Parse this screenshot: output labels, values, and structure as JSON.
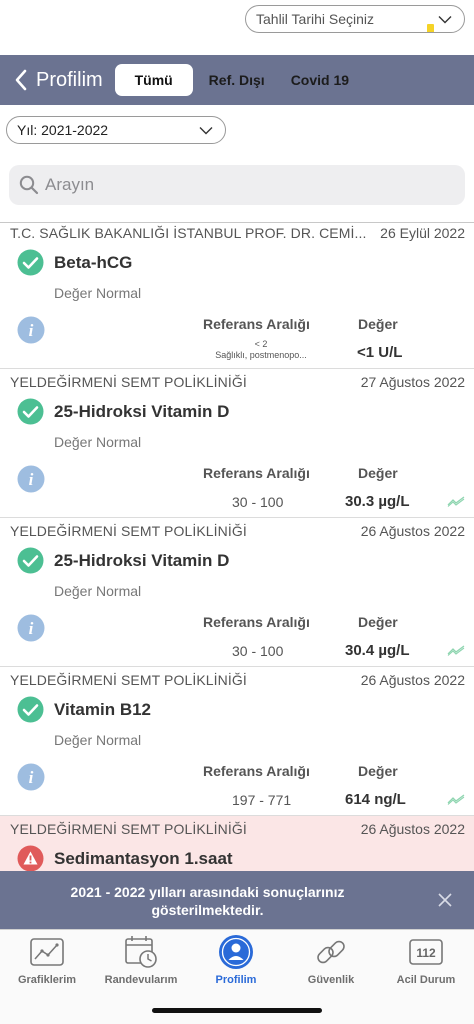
{
  "nav": {
    "back_label": "Profilim",
    "tabs": [
      "Tümü",
      "Ref. Dışı",
      "Covid 19"
    ]
  },
  "filters": {
    "year": "Yıl: 2021-2022",
    "date": "Tahlil Tarihi Seçiniz"
  },
  "search": {
    "placeholder": "Arayın"
  },
  "labels": {
    "ref_header": "Referans Aralığı",
    "val_header": "Değer"
  },
  "results": [
    {
      "institution": "T.C. SAĞLIK BAKANLIĞI İSTANBUL PROF. DR. CEMİ...",
      "date": "26 Eylül 2022",
      "test": "Beta-hCG",
      "status_text": "Değer Normal",
      "status": "normal",
      "ref_line1": "< 2",
      "ref_line2": "Sağlıklı, postmenopo...",
      "value": "<1 U/L"
    },
    {
      "institution": "YELDEĞİRMENİ SEMT POLİKLİNİĞİ",
      "date": "27 Ağustos 2022",
      "test": "25-Hidroksi Vitamin D",
      "status_text": "Değer Normal",
      "status": "normal",
      "ref": "30 - 100",
      "value": "30.3 µg/L"
    },
    {
      "institution": "YELDEĞİRMENİ SEMT POLİKLİNİĞİ",
      "date": "26 Ağustos 2022",
      "test": "25-Hidroksi Vitamin D",
      "status_text": "Değer Normal",
      "status": "normal",
      "ref": "30 - 100",
      "value": "30.4 µg/L"
    },
    {
      "institution": "YELDEĞİRMENİ SEMT POLİKLİNİĞİ",
      "date": "26 Ağustos 2022",
      "test": "Vitamin B12",
      "status_text": "Değer Normal",
      "status": "normal",
      "ref": "197 - 771",
      "value": "614 ng/L"
    },
    {
      "institution": "YELDEĞİRMENİ SEMT POLİKLİNİĞİ",
      "date": "26 Ağustos 2022",
      "test": "Sedimantasyon 1.saat",
      "status": "alert"
    }
  ],
  "toast": {
    "line1": "2021 - 2022 yılları arasındaki sonuçlarınız",
    "line2": "gösterilmektedir."
  },
  "tabbar": {
    "items": [
      "Grafiklerim",
      "Randevularım",
      "Profilim",
      "Güvenlik",
      "Acil Durum"
    ],
    "emergency_number": "112"
  },
  "colors": {
    "header": "#6b7391",
    "accent": "#2a6ad8",
    "normal": "#4cbf93",
    "alert": "#e05a5a",
    "alert_bg": "#fbe6e6"
  }
}
